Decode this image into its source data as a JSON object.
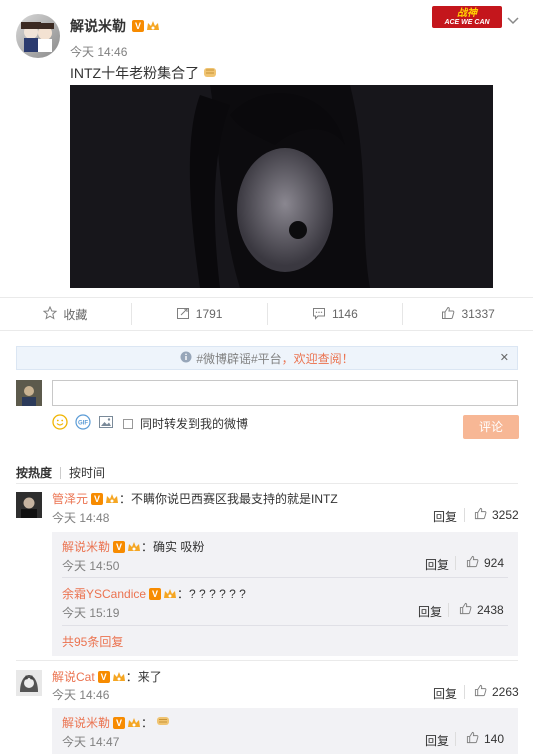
{
  "post": {
    "author": "解说米勒",
    "v_badge": "V",
    "time": "今天 14:46",
    "text": "INTZ十年老粉集合了",
    "logo_text": "ACE WE CAN",
    "logo_title": "战神"
  },
  "actions": {
    "favorite": "收藏",
    "forward": "1791",
    "comment": "1146",
    "like": "31337"
  },
  "notice": {
    "text_tag": "#微博辟谣#平台",
    "text_rest": "，欢迎查阅！",
    "close": "✕"
  },
  "composer": {
    "input_value": "",
    "also_repost": "同时转发到我的微博",
    "submit": "评论"
  },
  "sort": {
    "by_hot": "按热度",
    "by_time": "按时间"
  },
  "comments": [
    {
      "user": "管泽元",
      "text": "：不瞒你说巴西赛区我最支持的就是INTZ",
      "time": "今天 14:48",
      "reply": "回复",
      "likes": "3252",
      "replies": [
        {
          "user": "解说米勒",
          "text": "：确实 吸粉",
          "time": "今天 14:50",
          "reply": "回复",
          "likes": "924"
        },
        {
          "user": "余霜YSCandice",
          "text": "：? ? ? ? ? ?",
          "time": "今天 15:19",
          "reply": "回复",
          "likes": "2438"
        }
      ],
      "more": "共95条回复"
    },
    {
      "user": "解说Cat",
      "text": "：来了",
      "time": "今天 14:46",
      "reply": "回复",
      "likes": "2263",
      "replies": [
        {
          "user": "解说米勒",
          "text": "：",
          "time": "今天 14:47",
          "reply": "回复",
          "likes": "140"
        }
      ]
    }
  ],
  "colors": {
    "accent": "#eb7350",
    "notice_bg": "#eef4fb",
    "reply_bg": "#f2f2f5"
  }
}
